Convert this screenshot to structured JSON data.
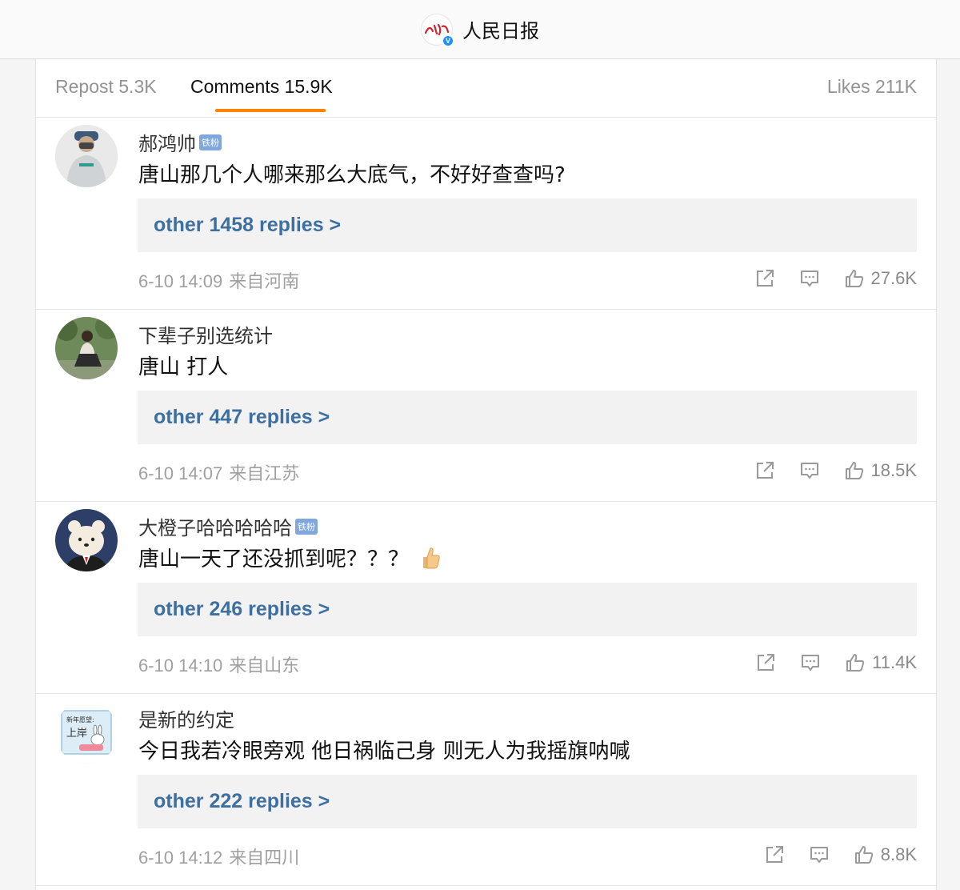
{
  "header": {
    "account_name": "人民日报",
    "logo_icon": "peoples-daily-logo",
    "verified_icon": "verified-badge-icon"
  },
  "tabs": {
    "repost": "Repost 5.3K",
    "comments": "Comments 15.9K",
    "likes": "Likes 211K",
    "active": "comments",
    "accent_color": "#ff8200"
  },
  "comments": [
    {
      "username": "郝鸿帅",
      "badge": "铁粉",
      "text": "唐山那几个人哪来那么大底气，不好好查查吗?",
      "replies": "other 1458 replies >",
      "time": "6-10 14:09",
      "location": "来自河南",
      "likes": "27.6K"
    },
    {
      "username": "下辈子别选统计",
      "badge": "",
      "text": "唐山 打人",
      "replies": "other 447 replies >",
      "time": "6-10 14:07",
      "location": "来自江苏",
      "likes": "18.5K"
    },
    {
      "username": "大橙子哈哈哈哈哈",
      "badge": "铁粉",
      "text": "唐山一天了还没抓到呢？？？",
      "replies": "other 246 replies >",
      "time": "6-10 14:10",
      "location": "来自山东",
      "likes": "11.4K"
    },
    {
      "username": "是新的约定",
      "badge": "",
      "text": "今日我若冷眼旁观 他日祸临己身 则无人为我摇旗呐喊",
      "replies": "other 222 replies >",
      "time": "6-10 14:12",
      "location": "来自四川",
      "likes": "8.8K"
    }
  ],
  "avatar_4_sign": {
    "line1": "新年愿望:",
    "line2": "上岸"
  },
  "colors": {
    "link": "#3e6fa1",
    "meta": "#a0a0a0",
    "fan_badge": "#7fa7dc"
  }
}
